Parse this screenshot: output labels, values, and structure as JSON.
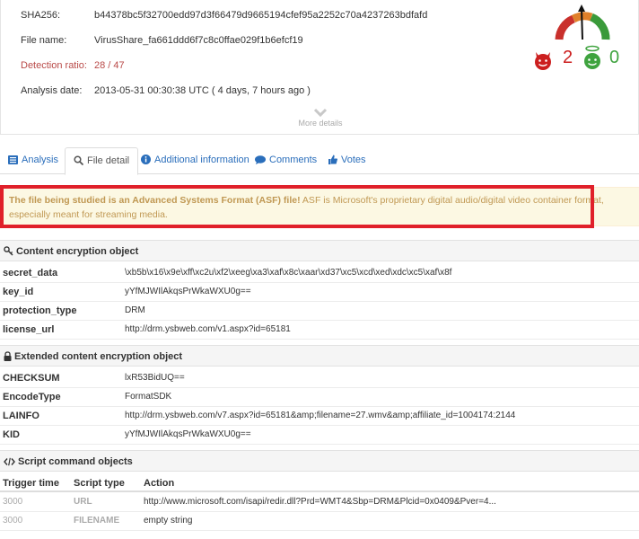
{
  "summary": {
    "sha256_label": "SHA256:",
    "sha256_value": "b44378bc5f32700edd97d3f66479d9665194cfef95a2252c70a4237263bdfafd",
    "file_name_label": "File name:",
    "file_name_value": "VirusShare_fa661ddd6f7c8c0ffae029f1b6efcf19",
    "detection_label": "Detection ratio:",
    "detection_value": "28 / 47",
    "analysis_label": "Analysis date:",
    "analysis_value": "2013-05-31 00:30:38 UTC ( 4 days, 7 hours ago )",
    "more_details": "More details",
    "malicious_votes": "2",
    "harmless_votes": "0"
  },
  "tabs": [
    {
      "label": "Analysis",
      "icon": "list-icon"
    },
    {
      "label": "File detail",
      "icon": "search-icon"
    },
    {
      "label": "Additional information",
      "icon": "info-icon"
    },
    {
      "label": "Comments",
      "icon": "comment-icon"
    },
    {
      "label": "Votes",
      "icon": "thumbs-up-icon"
    }
  ],
  "alert": {
    "bold": "The file being studied is an Advanced Systems Format (ASF) file!",
    "text": " ASF is Microsoft's proprietary digital audio/digital video container format, especially meant for streaming media."
  },
  "content_encryption": {
    "title": "Content encryption object",
    "rows": [
      {
        "key": "secret_data",
        "value": "\\xb5b\\x16\\x9e\\xff\\xc2u\\xf2\\xeeg\\xa3\\xaf\\x8c\\xaar\\xd37\\xc5\\xcd\\xed\\xdc\\xc5\\xaf\\x8f"
      },
      {
        "key": "key_id",
        "value": "yYfMJWIlAkqsPrWkaWXU0g=="
      },
      {
        "key": "protection_type",
        "value": "DRM"
      },
      {
        "key": "license_url",
        "value": "http://drm.ysbweb.com/v1.aspx?id=65181"
      }
    ]
  },
  "extended_encryption": {
    "title": "Extended content encryption object",
    "rows": [
      {
        "key": "CHECKSUM",
        "value": "lxR53BidUQ=="
      },
      {
        "key": "EncodeType",
        "value": "FormatSDK"
      },
      {
        "key": "LAINFO",
        "value": "http://drm.ysbweb.com/v7.aspx?id=65181&amp;filename=27.wmv&amp;affiliate_id=1004174:2144"
      },
      {
        "key": "KID",
        "value": "yYfMJWIlAkqsPrWkaWXU0g=="
      }
    ]
  },
  "script_commands": {
    "title": "Script command objects",
    "headers": [
      "Trigger time",
      "Script type",
      "Action"
    ],
    "rows": [
      {
        "time": "3000",
        "type": "URL",
        "action": "http://www.microsoft.com/isapi/redir.dll?Prd=WMT4&Sbp=DRM&Plcid=0x0409&Pver=4..."
      },
      {
        "time": "3000",
        "type": "FILENAME",
        "action": "empty string"
      }
    ]
  },
  "colors": {
    "link": "#2a6ebb",
    "alert_bg": "#fcf8e3",
    "alert_text": "#c09853",
    "highlight_outline": "#e0202a",
    "malicious": "#cc1f1f",
    "harmless": "#3fa33f"
  }
}
